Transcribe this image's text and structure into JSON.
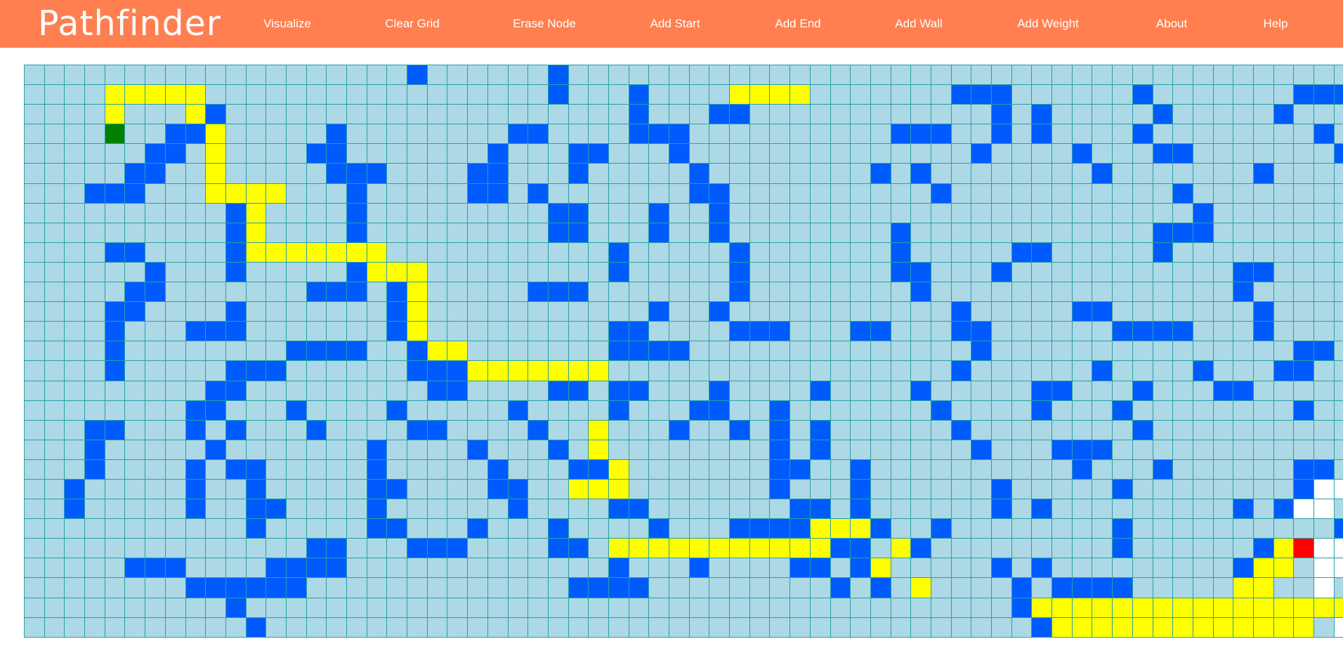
{
  "app": {
    "title": "Pathfinder"
  },
  "nav": [
    {
      "id": "visualize",
      "label": "Visualize"
    },
    {
      "id": "clear-grid",
      "label": "Clear Grid"
    },
    {
      "id": "erase-node",
      "label": "Erase Node"
    },
    {
      "id": "add-start",
      "label": "Add Start"
    },
    {
      "id": "add-end",
      "label": "Add End"
    },
    {
      "id": "add-wall",
      "label": "Add Wall"
    },
    {
      "id": "add-weight",
      "label": "Add Weight"
    },
    {
      "id": "about",
      "label": "About"
    },
    {
      "id": "help",
      "label": "Help"
    }
  ],
  "colors": {
    "navbar": "#ff7f50",
    "cell": "#add8e6",
    "wall": "#005bff",
    "path": "#ffff00",
    "start": "#008000",
    "end": "#ff0000",
    "empty": "#ffffff",
    "grid_line": "#27a0a6"
  },
  "grid": {
    "rows": 29,
    "cols": 66,
    "legend": {
      ".": "open",
      "#": "wall",
      "*": "path",
      "S": "start",
      "E": "end",
      "o": "unvisited"
    },
    "map": [
      "...................#......#.......................................",
      "....*****.................#...#....****.......###......#.......###",
      "....*...*#....................#...##............#.#.....#.....#...",
      "....S..##*.....#........##....###..........###..#.#....#........#...",
      "......##.*....##.......#...##...#..............#....#...##.......#",
      ".....##..*.....###....##...#.....#........#.#........#.......#....",
      "...###...****...#.....##.#.......##..........#...........#.......",
      "..........#*....#.........##...#..#.......................#......",
      "..........#*....#.........##...#..#........#............###......",
      "....##....#*******...........#.....#.......#.....##.....#........",
      "......#...#.....#***.........#.....#.......##...#...........##...",
      ".....##.......###.#*.....###.......#........#...............#....",
      "....##....#.......#*...........#..#...........#.....##.......#....",
      "....#...###.......#*.........##....###...##...##......####...#....",
      "....#........####..#**.......####..............#...............##.",
      "....#.....###......###*******.................#......#....#...##..",
      ".........##.........##....##.##...#....#....#.....##...#...##.....",
      "........##...#....#.....#....#...##..#.......#....#...#........#...",
      "...##...#.#...#....##....#..*...#..#.#.#......#........#.........",
      "...#.....#.......#....#...#.*........#.#.......#...###...........",
      "...#....#.##.....#.....#...##*.......##..#..........#...#......##.",
      "..#.....#..#.....##....##..***.......#...#......#.....#........#ooo",
      "..#.....#..##....#......#....##.......##.#......#.#.........#.#oo",
      "...........#.....##...#...#....#...####***#..#........#..........#oo",
      "..............##...###....##.***********##.*#.........#......#*Eoo",
      ".....###....####.............#...#....##.#*.....#.#.........#**.oo",
      "........######.............####.........#.#.*....#.####.....**..o",
      "..........#......................................#*****************.o",
      "...........#......................................#*************.o"
    ]
  }
}
